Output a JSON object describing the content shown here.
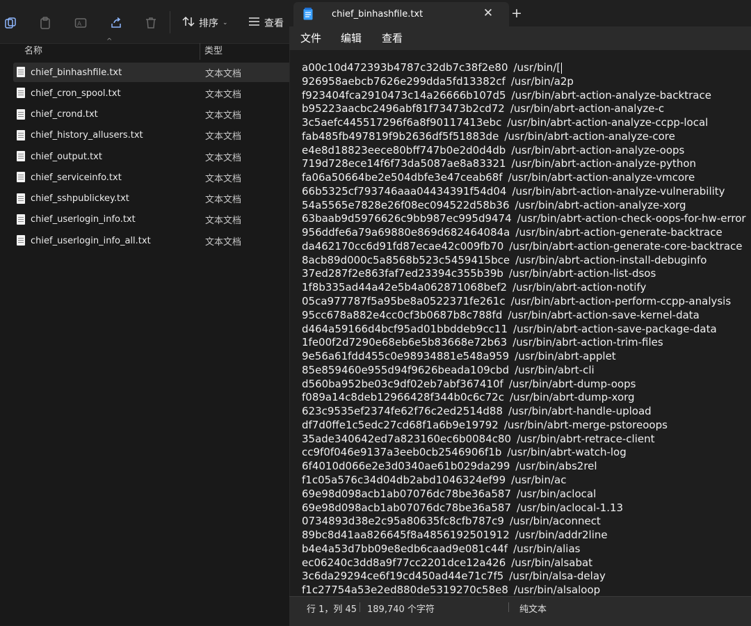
{
  "explorer": {
    "toolbar": {
      "sort_label": "排序",
      "view_label": "查看"
    },
    "columns": {
      "name": "名称",
      "type": "类型"
    },
    "files": [
      {
        "name": "chief_binhashfile.txt",
        "type": "文本文档",
        "selected": true
      },
      {
        "name": "chief_cron_spool.txt",
        "type": "文本文档"
      },
      {
        "name": "chief_crond.txt",
        "type": "文本文档"
      },
      {
        "name": "chief_history_allusers.txt",
        "type": "文本文档"
      },
      {
        "name": "chief_output.txt",
        "type": "文本文档"
      },
      {
        "name": "chief_serviceinfo.txt",
        "type": "文本文档"
      },
      {
        "name": "chief_sshpublickey.txt",
        "type": "文本文档"
      },
      {
        "name": "chief_userlogin_info.txt",
        "type": "文本文档"
      },
      {
        "name": "chief_userlogin_info_all.txt",
        "type": "文本文档"
      }
    ]
  },
  "notepad": {
    "tab_title": "chief_binhashfile.txt",
    "menu": [
      "文件",
      "编辑",
      "查看"
    ],
    "lines": [
      {
        "hash": "a00c10d472393b4787c32db7c38f2e80",
        "path": "/usr/bin/["
      },
      {
        "hash": "926958aebcb7626e299dda5fd13382cf",
        "path": "/usr/bin/a2p"
      },
      {
        "hash": "f923404fca2910473c14a26666b107d5",
        "path": "/usr/bin/abrt-action-analyze-backtrace"
      },
      {
        "hash": "b95223aacbc2496abf81f73473b2cd72",
        "path": "/usr/bin/abrt-action-analyze-c"
      },
      {
        "hash": "3c5aefc445517296f6a8f90117413ebc",
        "path": "/usr/bin/abrt-action-analyze-ccpp-local"
      },
      {
        "hash": "fab485fb497819f9b2636df5f51883de",
        "path": "/usr/bin/abrt-action-analyze-core"
      },
      {
        "hash": "e4e8d18823eece80bff747b0e2d0d4db",
        "path": "/usr/bin/abrt-action-analyze-oops"
      },
      {
        "hash": "719d728ece14f6f73da5087ae8a83321",
        "path": "/usr/bin/abrt-action-analyze-python"
      },
      {
        "hash": "fa06a50664be2e504dbfe3e47ceab68f",
        "path": "/usr/bin/abrt-action-analyze-vmcore"
      },
      {
        "hash": "66b5325cf793746aaa04434391f54d04",
        "path": "/usr/bin/abrt-action-analyze-vulnerability"
      },
      {
        "hash": "54a5565e7828e26f08ec094522d58b36",
        "path": "/usr/bin/abrt-action-analyze-xorg"
      },
      {
        "hash": "63baab9d5976626c9bb987ec995d9474",
        "path": "/usr/bin/abrt-action-check-oops-for-hw-error"
      },
      {
        "hash": "956ddfe6a79a69880e869d682464084a",
        "path": "/usr/bin/abrt-action-generate-backtrace"
      },
      {
        "hash": "da462170cc6d91fd87ecae42c009fb70",
        "path": "/usr/bin/abrt-action-generate-core-backtrace"
      },
      {
        "hash": "8acb89d000c5a8568b523c5459415bce",
        "path": "/usr/bin/abrt-action-install-debuginfo"
      },
      {
        "hash": "37ed287f2e863faf7ed23394c355b39b",
        "path": "/usr/bin/abrt-action-list-dsos"
      },
      {
        "hash": "1f8b335ad44a42e5b4a062871068bef2",
        "path": "/usr/bin/abrt-action-notify"
      },
      {
        "hash": "05ca977787f5a95be8a0522371fe261c",
        "path": "/usr/bin/abrt-action-perform-ccpp-analysis"
      },
      {
        "hash": "95cc678a882e4cc0cf3b0687b8c788fd",
        "path": "/usr/bin/abrt-action-save-kernel-data"
      },
      {
        "hash": "d464a59166d4bcf95ad01bbddeb9cc11",
        "path": "/usr/bin/abrt-action-save-package-data"
      },
      {
        "hash": "1fe00f2d7290e68eb6e5b83668e72b63",
        "path": "/usr/bin/abrt-action-trim-files"
      },
      {
        "hash": "9e56a61fdd455c0e98934881e548a959",
        "path": "/usr/bin/abrt-applet"
      },
      {
        "hash": "85e859460e955d94f9626beada109cbd",
        "path": "/usr/bin/abrt-cli"
      },
      {
        "hash": "d560ba952be03c9df02eb7abf367410f",
        "path": "/usr/bin/abrt-dump-oops"
      },
      {
        "hash": "f089a14c8deb12966428f344b0c6c72c",
        "path": "/usr/bin/abrt-dump-xorg"
      },
      {
        "hash": "623c9535ef2374fe62f76c2ed2514d88",
        "path": "/usr/bin/abrt-handle-upload"
      },
      {
        "hash": "df7d0ffe1c5edc27cd68f1a6b9e19792",
        "path": "/usr/bin/abrt-merge-pstoreoops"
      },
      {
        "hash": "35ade340642ed7a823160ec6b0084c80",
        "path": "/usr/bin/abrt-retrace-client"
      },
      {
        "hash": "cc9f0f046e9137a3eeb0cb2546906f1b",
        "path": "/usr/bin/abrt-watch-log"
      },
      {
        "hash": "6f4010d066e2e3d0340ae61b029da299",
        "path": "/usr/bin/abs2rel"
      },
      {
        "hash": "f1c05a576c34d04db2abd1046324ef99",
        "path": "/usr/bin/ac"
      },
      {
        "hash": "69e98d098acb1ab07076dc78be36a587",
        "path": "/usr/bin/aclocal"
      },
      {
        "hash": "69e98d098acb1ab07076dc78be36a587",
        "path": "/usr/bin/aclocal-1.13"
      },
      {
        "hash": "0734893d38e2c95a80635fc8cfb787c9",
        "path": "/usr/bin/aconnect"
      },
      {
        "hash": "89bc8d41aa826645f8a4856192501912",
        "path": "/usr/bin/addr2line"
      },
      {
        "hash": "b4e4a53d7bb09e8edb6caad9e081c44f",
        "path": "/usr/bin/alias"
      },
      {
        "hash": "ec06240c3dd8a9f77cc2201dce12a426",
        "path": "/usr/bin/alsabat"
      },
      {
        "hash": "3c6da29294ce6f19cd450ad44e71c7f5",
        "path": "/usr/bin/alsa-delay"
      },
      {
        "hash": "f1c27754a53e2ed880de5319270c58e8",
        "path": "/usr/bin/alsaloop"
      }
    ],
    "status": {
      "position": "行 1，列 45",
      "chars": "189,740 个字符",
      "encoding": "纯文本"
    }
  }
}
